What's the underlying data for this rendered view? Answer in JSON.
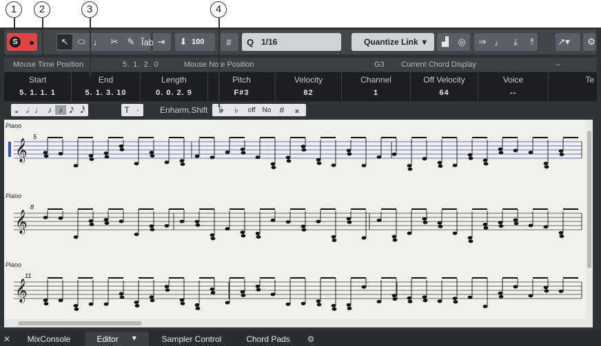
{
  "callouts": [
    "1",
    "2",
    "3",
    "4"
  ],
  "toolbar": {
    "solo": "S",
    "record": "●",
    "tools": [
      "↖",
      "⬭",
      "♩",
      "✂",
      "✎",
      "Ĩab"
    ],
    "velocity": "100",
    "grid_icon": "#",
    "q": "Q",
    "quantize": "1/16",
    "quantize_link": "Quantize Link",
    "gear": "⚙"
  },
  "infoline": {
    "mouse_time_label": "Mouse Time Position",
    "mouse_time_value": "5. 1. 2.    0",
    "mouse_note_label": "Mouse Note Position",
    "mouse_note_value": "G3",
    "chord_label": "Current Chord Display",
    "chord_value": "--"
  },
  "event": {
    "columns": [
      {
        "h": "Start",
        "v": "5. 1. 1.   1"
      },
      {
        "h": "End",
        "v": "5. 1. 3. 10"
      },
      {
        "h": "Length",
        "v": "0. 0. 2.   9"
      },
      {
        "h": "Pitch",
        "v": "F#3"
      },
      {
        "h": "Velocity",
        "v": "82"
      },
      {
        "h": "Channel",
        "v": "1"
      },
      {
        "h": "Off Velocity",
        "v": "64"
      },
      {
        "h": "Voice",
        "v": "--"
      },
      {
        "h": "Te",
        "v": ""
      }
    ]
  },
  "symbols": {
    "notes": [
      "𝅝",
      "𝅗𝅥",
      "♩",
      "♪",
      "♪",
      "𝅘𝅥𝅯",
      "𝅘𝅥𝅰"
    ],
    "tuplets": [
      "T",
      "·"
    ],
    "enharm_label": "Enharm.Shift",
    "enharm": [
      "𝄫",
      "♭",
      "off",
      "No",
      "#",
      "𝄪"
    ]
  },
  "score": {
    "systems": [
      {
        "label": "Piano",
        "measure": "5"
      },
      {
        "label": "Piano",
        "measure": "8"
      },
      {
        "label": "Piano",
        "measure": "11"
      }
    ]
  },
  "tabs": {
    "close": "✕",
    "items": [
      "MixConsole",
      "Editor",
      "Sampler Control",
      "Chord Pads"
    ],
    "gear": "⚙"
  }
}
